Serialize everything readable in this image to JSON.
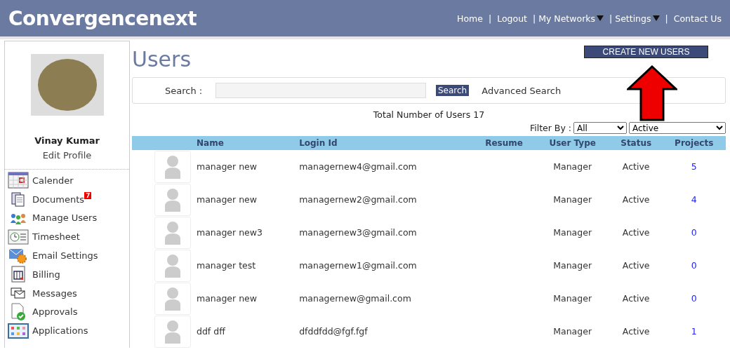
{
  "header": {
    "logo": "Convergencenext",
    "nav": [
      {
        "label": "Home",
        "separator": "|",
        "dropdown": false
      },
      {
        "label": "Logout",
        "dropdown": false
      },
      {
        "label": "| My Networks",
        "dropdown": true
      },
      {
        "label": "| Settings",
        "separator": "|",
        "dropdown": true
      },
      {
        "label": "Contact Us",
        "dropdown": false
      }
    ]
  },
  "profile": {
    "name": "Vinay Kumar",
    "edit_link": "Edit Profile"
  },
  "sidebar": {
    "items": [
      {
        "label": "Calender",
        "kind": "calendar"
      },
      {
        "label": "Documents",
        "kind": "documents",
        "badge": "7"
      },
      {
        "label": "Manage Users",
        "kind": "users"
      },
      {
        "label": "Timesheet",
        "kind": "timesheet"
      },
      {
        "label": "Email Settings",
        "kind": "email"
      },
      {
        "label": "Billing",
        "kind": "billing"
      },
      {
        "label": "Messages",
        "kind": "messages"
      },
      {
        "label": "Approvals",
        "kind": "approvals"
      },
      {
        "label": "Applications",
        "kind": "applications"
      }
    ]
  },
  "page_title": "Users",
  "create_button": "CREATE NEW USERS",
  "search": {
    "label": "Search :",
    "button": "Search",
    "advanced_link": "Advanced Search"
  },
  "total": "Total Number of Users 17",
  "filter": {
    "label": "Filter By :",
    "type_value": "All",
    "status_value": "Active"
  },
  "table": {
    "columns": [
      "Name",
      "Login Id",
      "Resume",
      "User Type",
      "Status",
      "Projects"
    ],
    "rows": [
      {
        "name": "manager new",
        "login": "managernew4@gmail.com",
        "user_type": "Manager",
        "status": "Active",
        "projects": "5"
      },
      {
        "name": "manager new",
        "login": "managernew2@gmail.com",
        "user_type": "Manager",
        "status": "Active",
        "projects": "4"
      },
      {
        "name": "manager new3",
        "login": "managernew3@gmail.com",
        "user_type": "Manager",
        "status": "Active",
        "projects": "0"
      },
      {
        "name": "manager test",
        "login": "managernew1@gmail.com",
        "user_type": "Manager",
        "status": "Active",
        "projects": "0"
      },
      {
        "name": "manager new",
        "login": "managernew@gmail.com",
        "user_type": "Manager",
        "status": "Active",
        "projects": "0"
      },
      {
        "name": "ddf dff",
        "login": "dfddfdd@fgf.fgf",
        "user_type": "Manager",
        "status": "Active",
        "projects": "1"
      }
    ]
  }
}
